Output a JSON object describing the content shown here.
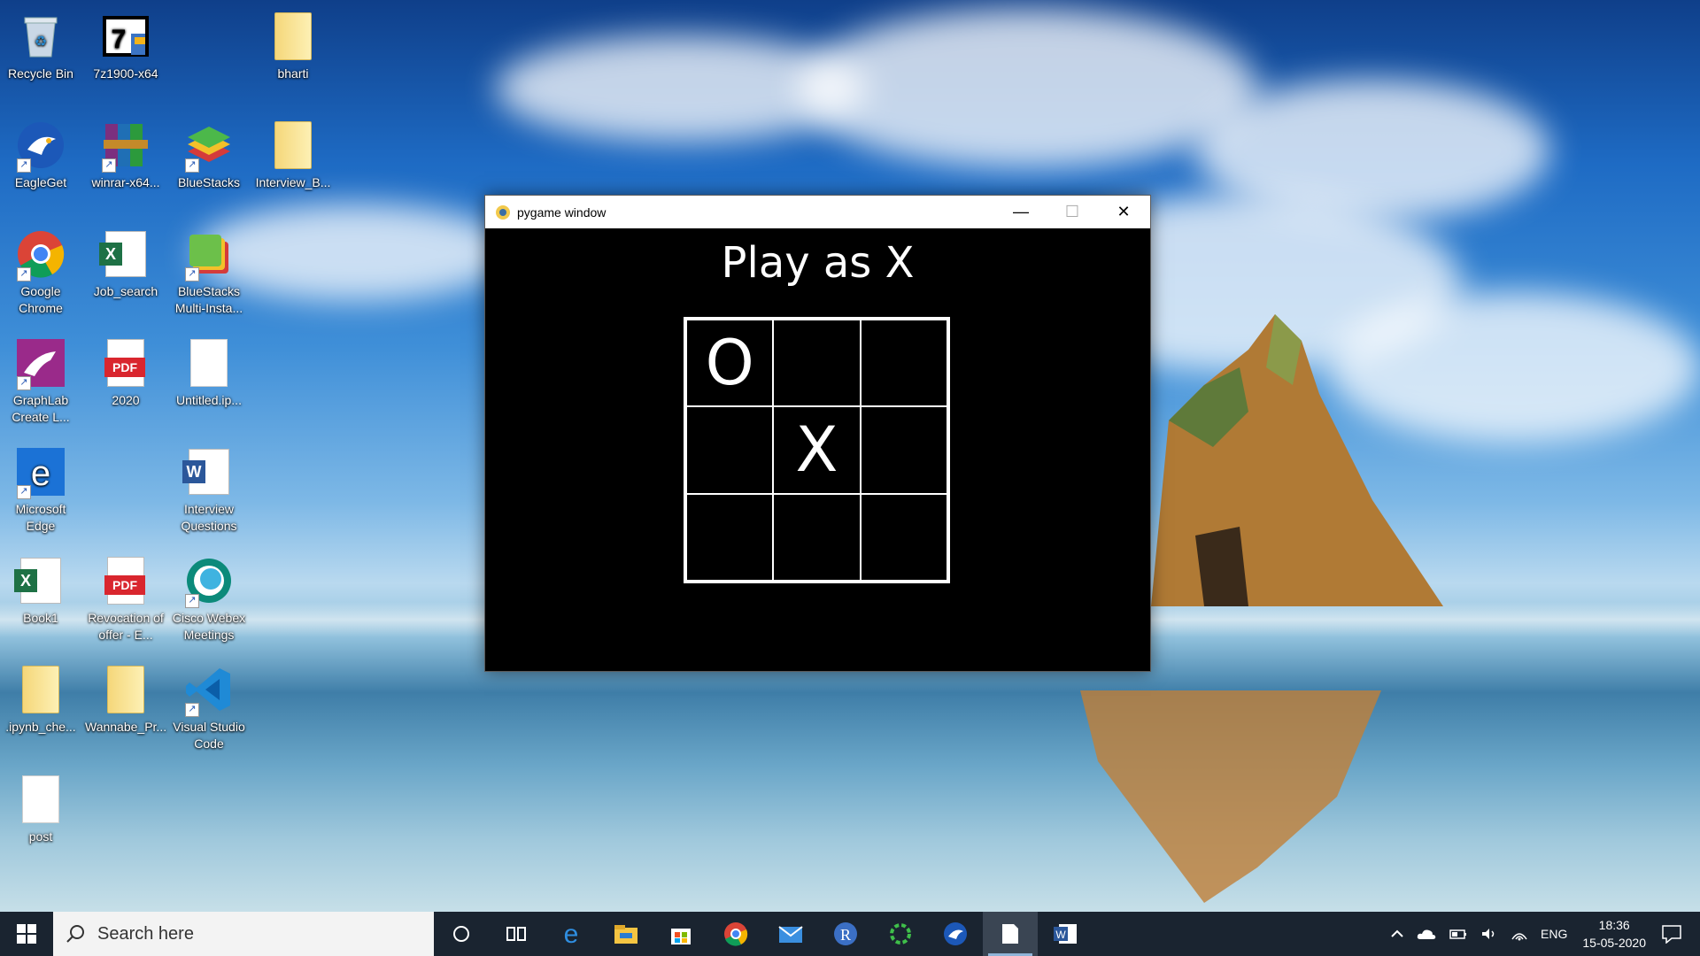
{
  "desktop": {
    "icons": [
      {
        "label": "Recycle Bin",
        "icon": "recycle-bin-icon"
      },
      {
        "label": "7z1900-x64",
        "icon": "7zip-installer-icon"
      },
      {
        "label": "bharti",
        "icon": "folder-icon"
      },
      {
        "label": "EagleGet",
        "icon": "eagleget-icon"
      },
      {
        "label": "winrar-x64...",
        "icon": "winrar-icon"
      },
      {
        "label": "BlueStacks",
        "icon": "bluestacks-icon"
      },
      {
        "label": "Interview_B...",
        "icon": "folder-icon"
      },
      {
        "label": "Google Chrome",
        "icon": "chrome-icon"
      },
      {
        "label": "Job_search",
        "icon": "excel-file-icon"
      },
      {
        "label": "BlueStacks Multi-Insta...",
        "icon": "bluestacks-multi-icon"
      },
      {
        "label": "GraphLab Create L...",
        "icon": "graphlab-icon"
      },
      {
        "label": "2020",
        "icon": "pdf-file-icon"
      },
      {
        "label": "Untitled.ip...",
        "icon": "blank-file-icon"
      },
      {
        "label": "Microsoft Edge",
        "icon": "edge-icon"
      },
      {
        "label": "Interview Questions",
        "icon": "word-file-icon"
      },
      {
        "label": "Book1",
        "icon": "excel-file-icon"
      },
      {
        "label": "Revocation of offer - E...",
        "icon": "pdf-file-icon"
      },
      {
        "label": "Cisco Webex Meetings",
        "icon": "webex-icon"
      },
      {
        "label": ".ipynb_che...",
        "icon": "folder-icon"
      },
      {
        "label": "Wannabe_Pr...",
        "icon": "folder-icon"
      },
      {
        "label": "Visual Studio Code",
        "icon": "vscode-icon"
      },
      {
        "label": "post",
        "icon": "blank-file-icon"
      }
    ]
  },
  "window": {
    "title": "pygame window",
    "minimize": "—",
    "maximize": "☐",
    "close": "✕",
    "heading": "Play as X",
    "board": [
      "O",
      "",
      "",
      "",
      "X",
      "",
      "",
      "",
      ""
    ]
  },
  "taskbar": {
    "search_placeholder": "Search here",
    "apps": [
      "cortana-icon",
      "task-view-icon",
      "edge-icon",
      "file-explorer-icon",
      "store-icon",
      "chrome-icon",
      "mail-icon",
      "r-icon",
      "green-ring-icon",
      "eagleget-icon",
      "notepad-file-icon",
      "word-icon"
    ],
    "tray": {
      "language": "ENG",
      "time": "18:36",
      "date": "15-05-2020"
    }
  },
  "colors": {
    "taskbar": "#1a2430",
    "window_bg": "#000000",
    "board_line": "#ffffff"
  }
}
